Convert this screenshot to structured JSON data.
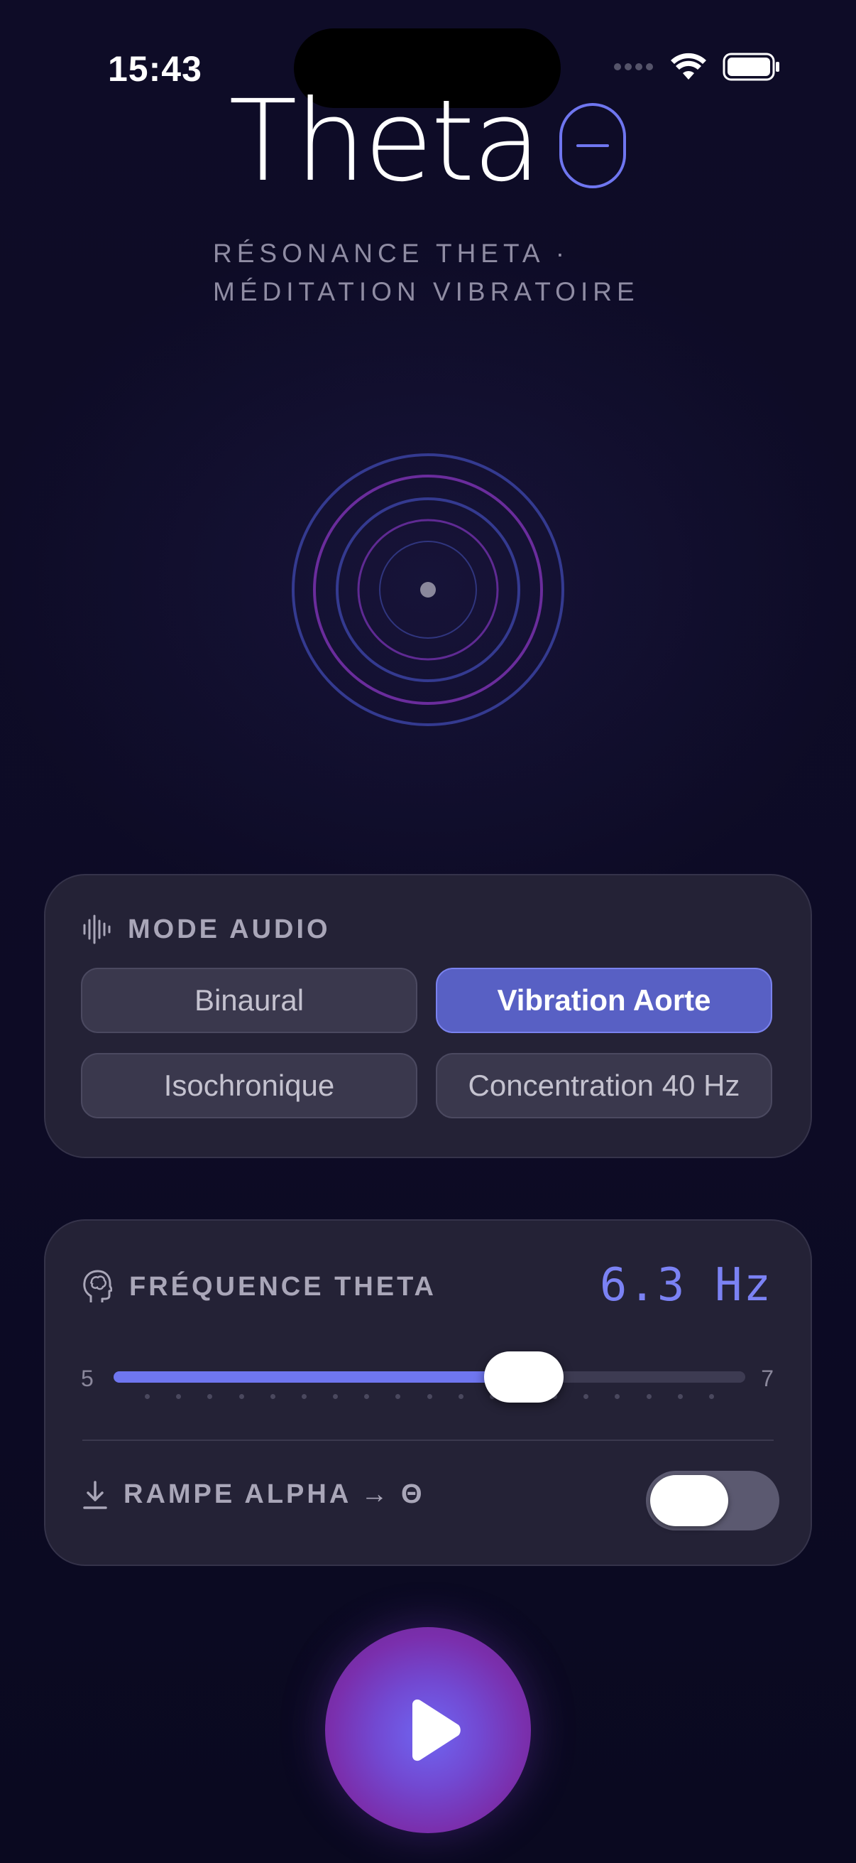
{
  "status_bar": {
    "time": "15:43"
  },
  "header": {
    "title": "Theta",
    "subtitle_line1": "RÉSONANCE THETA  ·",
    "subtitle_line2": "MÉDITATION VIBRATOIRE"
  },
  "mode_card": {
    "label": "MODE AUDIO",
    "icon": "waveform-icon",
    "options": [
      {
        "label": "Binaural",
        "selected": false
      },
      {
        "label": "Vibration Aorte",
        "selected": true
      },
      {
        "label": "Isochronique",
        "selected": false
      },
      {
        "label": "Concentration 40 Hz",
        "selected": false
      }
    ]
  },
  "frequency_card": {
    "label": "FRÉQUENCE THETA",
    "icon": "brain-head-icon",
    "value_text": "6.3 Hz",
    "min_label": "5",
    "max_label": "7",
    "value": 6.3,
    "min": 5,
    "max": 7
  },
  "ramp": {
    "label": "RAMPE ALPHA → Θ",
    "icon": "download-arrow-icon",
    "enabled": false
  },
  "play_button": {
    "icon": "play-icon"
  },
  "colors": {
    "background": "#0d0b24",
    "card": "#242236",
    "accent": "#6f76f0",
    "selected": "#5860c4",
    "ring_blue": "#3a3f9a",
    "ring_purple": "#7a2fa3"
  }
}
